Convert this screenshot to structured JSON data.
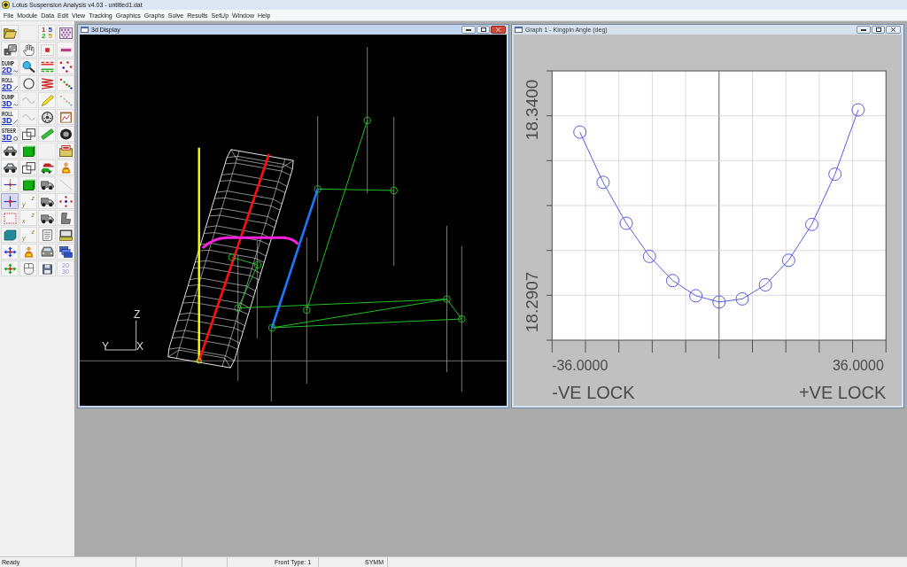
{
  "window": {
    "title": "Lotus Suspension Analysis v4.03 - untitled1.dat"
  },
  "menu": [
    "File",
    "Module",
    "Data",
    "Edit",
    "View",
    "Tracking",
    "Graphics",
    "Graphs",
    "Solve",
    "Results",
    "SetUp",
    "Window",
    "Help"
  ],
  "toolbar": [
    {
      "kind": "folder",
      "disabled": false,
      "pressed": false
    },
    {
      "kind": "blank",
      "disabled": true,
      "pressed": false
    },
    {
      "kind": "numbers",
      "lines": [
        "1 5",
        "2 5"
      ],
      "disabled": false,
      "pressed": false
    },
    {
      "kind": "pattern",
      "disabled": false,
      "pressed": false
    },
    {
      "kind": "cubes",
      "disabled": false,
      "pressed": false
    },
    {
      "kind": "hand",
      "disabled": false,
      "pressed": false
    },
    {
      "kind": "target",
      "disabled": false,
      "pressed": false
    },
    {
      "kind": "mark",
      "disabled": false,
      "pressed": false
    },
    {
      "kind": "dump-mode",
      "lines": [
        "DUMP",
        "2D"
      ],
      "disabled": false,
      "pressed": false
    },
    {
      "kind": "magnifier",
      "disabled": false,
      "pressed": false
    },
    {
      "kind": "bars",
      "disabled": false,
      "pressed": false
    },
    {
      "kind": "dots",
      "disabled": false,
      "pressed": false
    },
    {
      "kind": "roll-mode",
      "lines": [
        "ROLL",
        "2D"
      ],
      "disabled": false,
      "pressed": false
    },
    {
      "kind": "ring",
      "disabled": false,
      "pressed": false
    },
    {
      "kind": "spring",
      "disabled": false,
      "pressed": false
    },
    {
      "kind": "scatter",
      "disabled": false,
      "pressed": false
    },
    {
      "kind": "dump-mode",
      "lines": [
        "DUMP",
        "3D"
      ],
      "disabled": false,
      "pressed": false
    },
    {
      "kind": "wave",
      "disabled": true,
      "pressed": false
    },
    {
      "kind": "pencil",
      "disabled": false,
      "pressed": false
    },
    {
      "kind": "scatter",
      "disabled": true,
      "pressed": false
    },
    {
      "kind": "roll-mode",
      "lines": [
        "ROLL",
        "3D"
      ],
      "disabled": false,
      "pressed": false
    },
    {
      "kind": "wave",
      "disabled": true,
      "pressed": false
    },
    {
      "kind": "wheel",
      "disabled": false,
      "pressed": false
    },
    {
      "kind": "clipboard",
      "disabled": false,
      "pressed": false
    },
    {
      "kind": "steer-mode",
      "lines": [
        "STEER",
        "3D"
      ],
      "disabled": false,
      "pressed": false
    },
    {
      "kind": "cube-outline",
      "disabled": false,
      "pressed": false
    },
    {
      "kind": "bar",
      "disabled": false,
      "pressed": false
    },
    {
      "kind": "tire",
      "disabled": false,
      "pressed": false
    },
    {
      "kind": "car",
      "disabled": false,
      "pressed": false
    },
    {
      "kind": "cube-solid",
      "disabled": false,
      "pressed": false
    },
    {
      "kind": "blank",
      "disabled": true,
      "pressed": false
    },
    {
      "kind": "crate",
      "disabled": false,
      "pressed": false
    },
    {
      "kind": "car",
      "disabled": false,
      "pressed": false
    },
    {
      "kind": "cube-outline",
      "disabled": false,
      "pressed": false
    },
    {
      "kind": "cars",
      "disabled": false,
      "pressed": false
    },
    {
      "kind": "figure",
      "disabled": false,
      "pressed": false
    },
    {
      "kind": "axes",
      "disabled": false,
      "pressed": false
    },
    {
      "kind": "cube-solid",
      "disabled": false,
      "pressed": false
    },
    {
      "kind": "truck",
      "disabled": false,
      "pressed": false
    },
    {
      "kind": "line",
      "disabled": true,
      "pressed": false
    },
    {
      "kind": "cross",
      "disabled": false,
      "pressed": true
    },
    {
      "kind": "xyz",
      "lines": [
        "z",
        "y"
      ],
      "disabled": false,
      "pressed": false
    },
    {
      "kind": "truck",
      "disabled": false,
      "pressed": false
    },
    {
      "kind": "cross-dots",
      "disabled": false,
      "pressed": false
    },
    {
      "kind": "dotted-square",
      "disabled": false,
      "pressed": false
    },
    {
      "kind": "xyz",
      "lines": [
        "z",
        "x"
      ],
      "disabled": false,
      "pressed": false
    },
    {
      "kind": "truck",
      "disabled": false,
      "pressed": false
    },
    {
      "kind": "seat",
      "disabled": false,
      "pressed": false
    },
    {
      "kind": "tag",
      "disabled": false,
      "pressed": false
    },
    {
      "kind": "xyz",
      "lines": [
        "z",
        "y"
      ],
      "disabled": false,
      "pressed": false
    },
    {
      "kind": "scroll",
      "disabled": false,
      "pressed": false
    },
    {
      "kind": "monitor",
      "disabled": false,
      "pressed": false
    },
    {
      "kind": "move",
      "disabled": false,
      "pressed": false
    },
    {
      "kind": "figure",
      "disabled": false,
      "pressed": false
    },
    {
      "kind": "car-front",
      "disabled": false,
      "pressed": false
    },
    {
      "kind": "windows",
      "disabled": false,
      "pressed": false
    },
    {
      "kind": "move-alt",
      "disabled": false,
      "pressed": false
    },
    {
      "kind": "mouse",
      "disabled": false,
      "pressed": false
    },
    {
      "kind": "floppy",
      "disabled": false,
      "pressed": false
    },
    {
      "kind": "years",
      "lines": [
        "20",
        "30"
      ],
      "disabled": false,
      "pressed": false
    }
  ],
  "windows": [
    {
      "kind": "display3d",
      "title": "3d Display",
      "active": true,
      "axis_labels": [
        "Z",
        "Y",
        "X"
      ]
    },
    {
      "kind": "graph",
      "title": "Graph 1 - Kingpin Angle (deg)",
      "active": false,
      "chart_data": {
        "type": "line",
        "x": [
          -36,
          -30,
          -24,
          -18,
          -12,
          -6,
          0,
          6,
          12,
          18,
          24,
          30,
          36
        ],
        "series": [
          {
            "color": "#5a5ae0",
            "marker": "circle",
            "values": [
              18.3343,
              18.3214,
              18.3109,
              18.3024,
              18.2962,
              18.2923,
              18.2907,
              18.2915,
              18.2951,
              18.3014,
              18.3106,
              18.3235,
              18.34
            ]
          }
        ],
        "xlim": [
          -43.2,
          43.2
        ],
        "ylim": [
          18.2809,
          18.35
        ],
        "xticks": [
          {
            "value": -36,
            "label": "-36.0000"
          },
          {
            "value": 36,
            "label": "36.0000"
          }
        ],
        "yticks": [
          {
            "value": 18.2907,
            "label": "18.2907"
          },
          {
            "value": 18.34,
            "label": "18.3400"
          }
        ]
      },
      "lock_labels": [
        "-VE LOCK",
        "+VE LOCK"
      ]
    }
  ],
  "status_bar": [
    "Ready",
    "Front Type: 1",
    "SYMM"
  ]
}
